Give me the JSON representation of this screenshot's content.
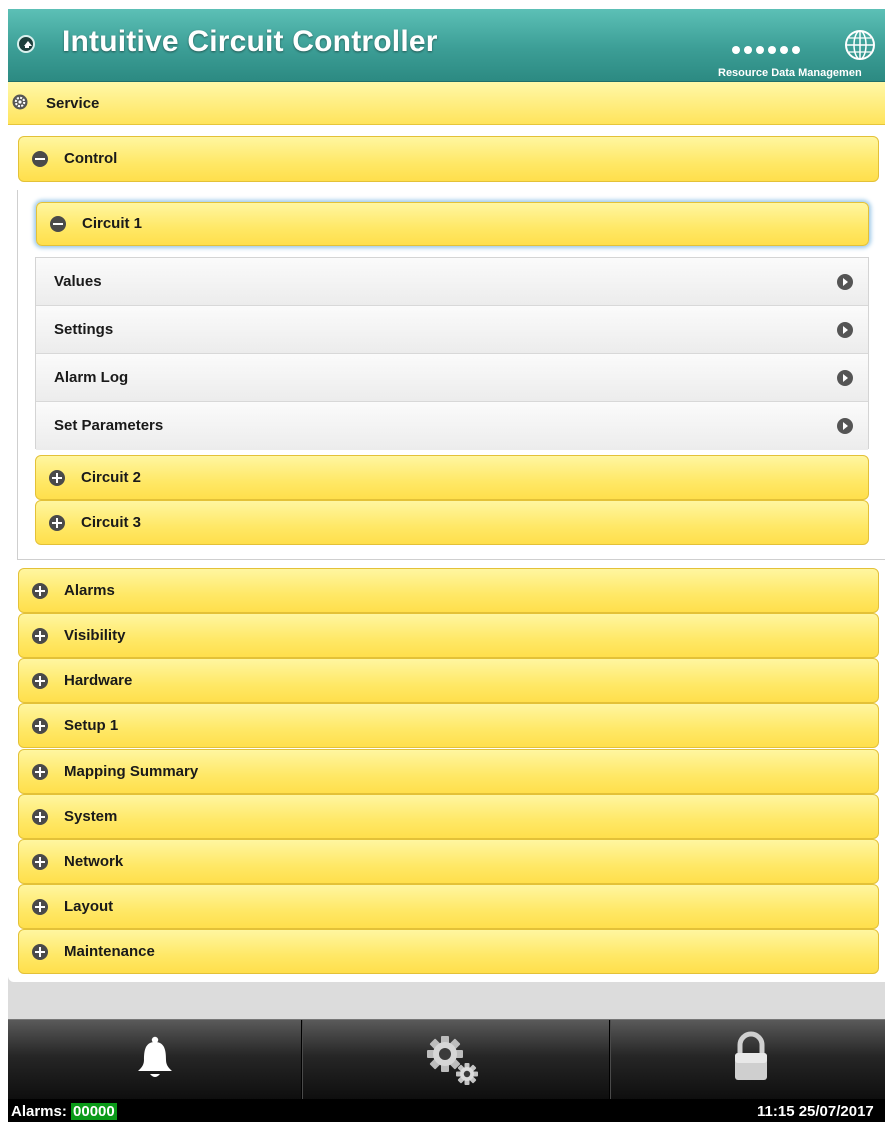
{
  "header": {
    "title": "Intuitive Circuit Controller",
    "logo_text": "Resource Data Managemen",
    "home_icon": "home-icon",
    "logo_icon": "globe-icon"
  },
  "service": {
    "label": "Service",
    "icon": "gear-icon"
  },
  "control": {
    "label": "Control",
    "expanded": true,
    "circuits": [
      {
        "label": "Circuit 1",
        "expanded": true,
        "items": [
          "Values",
          "Settings",
          "Alarm Log",
          "Set Parameters"
        ]
      },
      {
        "label": "Circuit 2",
        "expanded": false
      },
      {
        "label": "Circuit 3",
        "expanded": false
      }
    ]
  },
  "sections": [
    "Alarms",
    "Visibility",
    "Hardware",
    "Setup 1",
    "Mapping Summary",
    "System",
    "Network",
    "Layout",
    "Maintenance"
  ],
  "toolbar": {
    "buttons": [
      "bell-icon",
      "gears-icon",
      "lock-icon"
    ]
  },
  "status": {
    "alarms_label": "Alarms: ",
    "alarm_count": "00000",
    "datetime": "11:15 25/07/2017"
  },
  "colors": {
    "header": "#3c9e96",
    "accordion": "#ffe866",
    "alarm_count_bg": "#0a9a18"
  }
}
